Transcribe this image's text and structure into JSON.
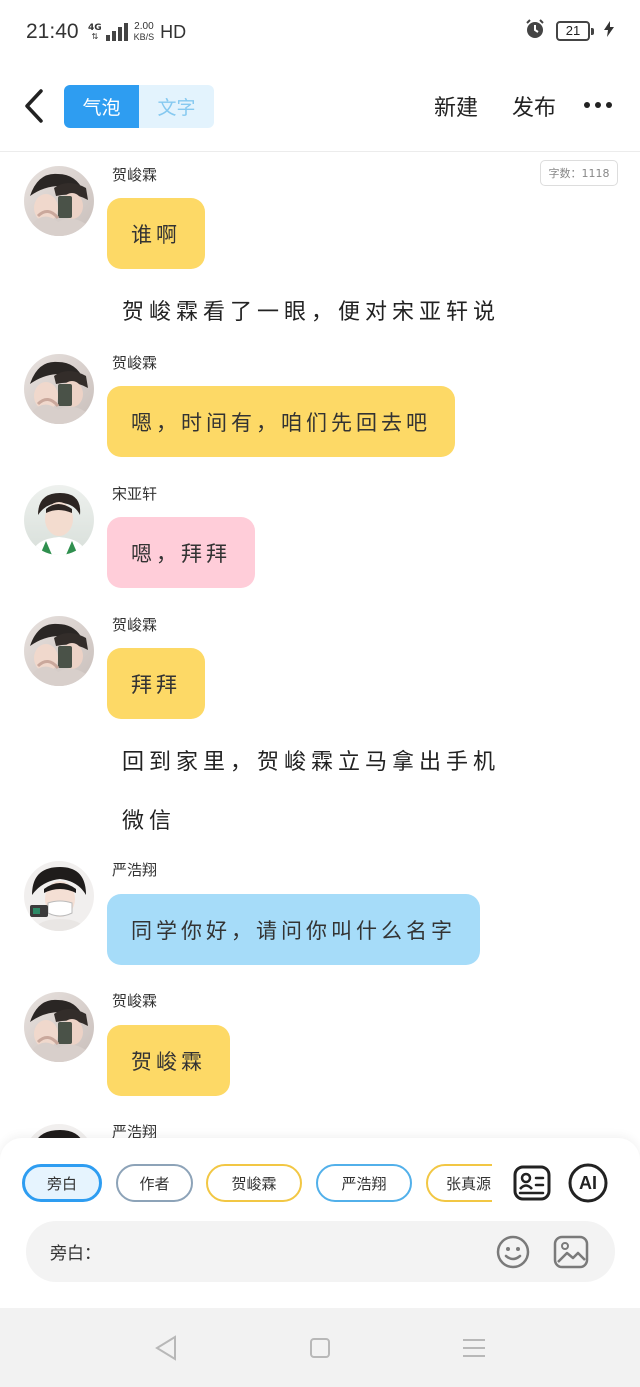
{
  "status_bar": {
    "time": "21:40",
    "network": "4G",
    "speed_value": "2.00",
    "speed_unit": "KB/S",
    "hd": "HD",
    "battery": "21"
  },
  "header": {
    "tabs": [
      {
        "label": "气泡",
        "active": true
      },
      {
        "label": "文字",
        "active": false
      }
    ],
    "new_label": "新建",
    "publish_label": "发布"
  },
  "word_count": "字数：1118",
  "messages": [
    {
      "type": "bubble",
      "sender": "贺峻霖",
      "text": "谁啊",
      "color": "#fdd966",
      "avatar": "he"
    },
    {
      "type": "narration",
      "text": "贺峻霖看了一眼，便对宋亚轩说"
    },
    {
      "type": "bubble",
      "sender": "贺峻霖",
      "text": "嗯，时间有，咱们先回去吧",
      "color": "#fdd966",
      "avatar": "he"
    },
    {
      "type": "bubble",
      "sender": "宋亚轩",
      "text": "嗯，拜拜",
      "color": "#ffcdd9",
      "avatar": "song"
    },
    {
      "type": "bubble",
      "sender": "贺峻霖",
      "text": "拜拜",
      "color": "#fdd966",
      "avatar": "he"
    },
    {
      "type": "narration",
      "text": "回到家里，贺峻霖立马拿出手机"
    },
    {
      "type": "narration",
      "text": "微信"
    },
    {
      "type": "bubble",
      "sender": "严浩翔",
      "text": "同学你好，请问你叫什么名字",
      "color": "#a6dcf9",
      "avatar": "yan"
    },
    {
      "type": "bubble",
      "sender": "贺峻霖",
      "text": "贺峻霖",
      "color": "#fdd966",
      "avatar": "he"
    },
    {
      "type": "partial",
      "sender": "严浩翔",
      "avatar": "yan"
    }
  ],
  "roles": [
    {
      "label": "旁白",
      "selected": true
    },
    {
      "label": "作者",
      "selected": false
    },
    {
      "label": "贺峻霖",
      "selected": false
    },
    {
      "label": "严浩翔",
      "selected": false
    },
    {
      "label": "张真源",
      "selected": false
    }
  ],
  "ai_label": "AI",
  "input": {
    "label": "旁白："
  },
  "colors": {
    "accent": "#2e9df1",
    "yellow_bubble": "#fdd966",
    "pink_bubble": "#ffcdd9",
    "blue_bubble": "#a6dcf9"
  },
  "icons": {
    "back": "chevron-left-icon",
    "more": "more-dots-icon",
    "character_card": "character-card-icon",
    "emoji": "emoji-icon",
    "image": "image-icon",
    "nav_back": "triangle-back-icon",
    "nav_home": "square-home-icon",
    "nav_menu": "menu-lines-icon"
  }
}
